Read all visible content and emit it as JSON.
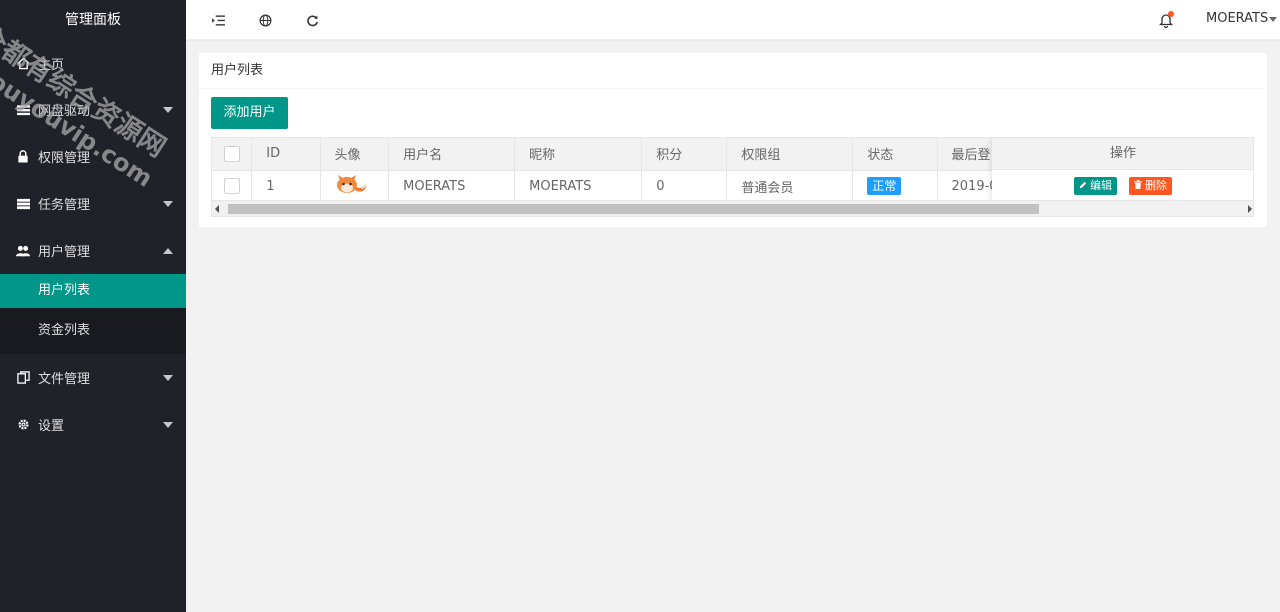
{
  "sidebar": {
    "logo": "管理面板",
    "items": [
      {
        "label": "主页",
        "icon": "home-icon"
      },
      {
        "label": "网盘驱动",
        "icon": "list-icon"
      },
      {
        "label": "权限管理",
        "icon": "lock-icon"
      },
      {
        "label": "任务管理",
        "icon": "server-icon"
      },
      {
        "label": "用户管理",
        "icon": "users-icon"
      },
      {
        "label": "文件管理",
        "icon": "files-icon"
      },
      {
        "label": "设置",
        "icon": "gear-icon"
      }
    ],
    "submenu": [
      {
        "label": "用户列表",
        "active": true
      },
      {
        "label": "资金列表",
        "active": false
      }
    ]
  },
  "header": {
    "user_name": "MOERATS",
    "icons": [
      "menu-shrink-icon",
      "globe-icon",
      "refresh-icon",
      "bell-icon"
    ]
  },
  "card": {
    "title": "用户列表",
    "add_button": "添加用户",
    "columns": [
      "",
      "ID",
      "头像",
      "用户名",
      "昵称",
      "积分",
      "权限组",
      "状态",
      "最后登"
    ],
    "action_header": "操作",
    "rows": [
      {
        "id": "1",
        "username": "MOERATS",
        "nickname": "MOERATS",
        "points": "0",
        "group": "普通会员",
        "status": "正常",
        "last_login": "2019-0"
      }
    ],
    "edit_label": "编辑",
    "delete_label": "删除",
    "horizontal_scroll_fraction": 0.79
  },
  "watermark": {
    "line1": "全都有综合资源网",
    "line2": "douyouvip.com"
  },
  "colors": {
    "sidebar_bg": "#20222a",
    "accent": "#009688",
    "danger": "#ff5722",
    "info": "#1e9fff"
  }
}
